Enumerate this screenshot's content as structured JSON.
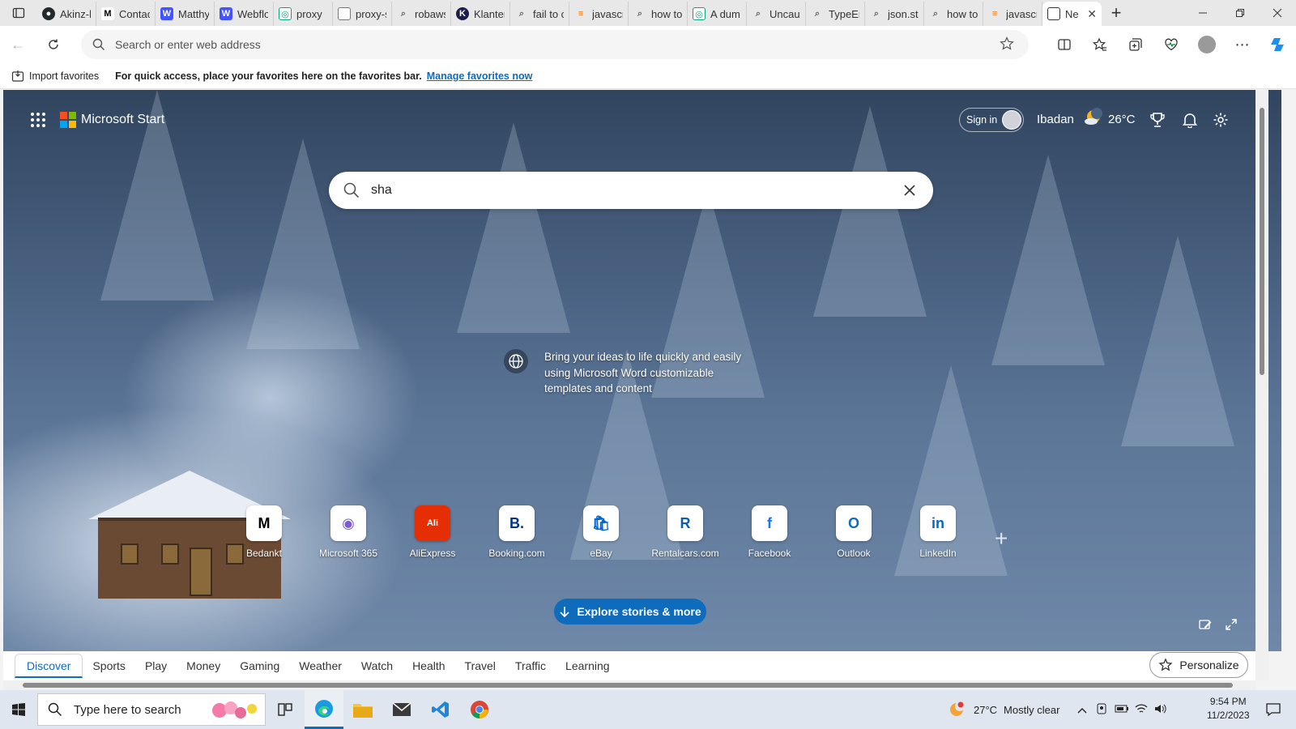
{
  "browser": {
    "tabs": [
      {
        "label": "Akinz-l",
        "icon": "github-icon"
      },
      {
        "label": "Contac",
        "icon": "m-logo-icon"
      },
      {
        "label": "Matthy",
        "icon": "webflow-icon"
      },
      {
        "label": "Webflo",
        "icon": "webflow-icon"
      },
      {
        "label": "proxy",
        "icon": "chatgpt-icon"
      },
      {
        "label": "proxy-s",
        "icon": "page-icon"
      },
      {
        "label": "robaws",
        "icon": "search-icon"
      },
      {
        "label": "Klanter",
        "icon": "klant-icon"
      },
      {
        "label": "fail to c",
        "icon": "search-icon"
      },
      {
        "label": "javascr",
        "icon": "stackoverflow-icon"
      },
      {
        "label": "how to",
        "icon": "search-icon"
      },
      {
        "label": "A dum",
        "icon": "chatgpt-icon"
      },
      {
        "label": "Uncau",
        "icon": "search-icon"
      },
      {
        "label": "TypeEr",
        "icon": "search-icon"
      },
      {
        "label": "json.st",
        "icon": "search-icon"
      },
      {
        "label": "how to",
        "icon": "search-icon"
      },
      {
        "label": "javascr",
        "icon": "stackoverflow-icon"
      },
      {
        "label": "Ne",
        "icon": "newtab-icon",
        "active": true
      }
    ],
    "address_placeholder": "Search or enter web address",
    "favbar": {
      "import_label": "Import favorites",
      "message": "For quick access, place your favorites here on the favorites bar.",
      "link": "Manage favorites now"
    }
  },
  "start": {
    "brand": "Microsoft Start",
    "signin": "Sign in",
    "location": "Ibadan",
    "temperature": "26°C",
    "search_query": "sha",
    "promo": "Bring your ideas to life quickly and easily using Microsoft Word customizable templates and content",
    "tiles": [
      {
        "label": "Bedankt",
        "glyph": "M",
        "color": "#000000"
      },
      {
        "label": "Microsoft 365",
        "glyph": "◉",
        "color": "#7b5cd6"
      },
      {
        "label": "AliExpress",
        "glyph": "Ali",
        "color": "#e62e04"
      },
      {
        "label": "Booking.com",
        "glyph": "B.",
        "color": "#003580"
      },
      {
        "label": "eBay",
        "glyph": "🛍",
        "color": "#0064d2"
      },
      {
        "label": "Rentalcars.com",
        "glyph": "R",
        "color": "#0a5eb0"
      },
      {
        "label": "Facebook",
        "glyph": "f",
        "color": "#1877f2"
      },
      {
        "label": "Outlook",
        "glyph": "O",
        "color": "#0f6cbd"
      },
      {
        "label": "LinkedIn",
        "glyph": "in",
        "color": "#0a66c2"
      }
    ],
    "explore": "Explore stories & more",
    "categories": [
      "Discover",
      "Sports",
      "Play",
      "Money",
      "Gaming",
      "Weather",
      "Watch",
      "Health",
      "Travel",
      "Traffic",
      "Learning"
    ],
    "personalize": "Personalize"
  },
  "taskbar": {
    "search_placeholder": "Type here to search",
    "weather_temp": "27°C",
    "weather_desc": "Mostly clear",
    "time": "9:54 PM",
    "date": "11/2/2023"
  },
  "colors": {
    "accent": "#0f6cbd"
  }
}
